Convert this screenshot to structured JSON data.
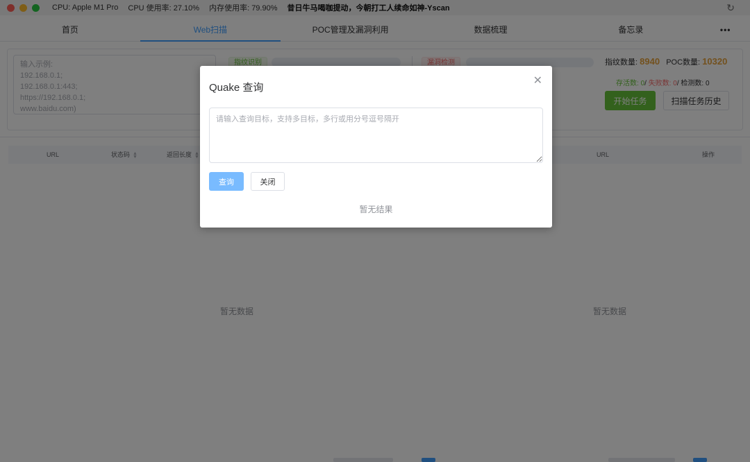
{
  "titlebar": {
    "cpu_model": "CPU: Apple M1 Pro",
    "cpu_usage": "CPU 使用率: 27.10%",
    "mem_usage": "内存使用率: 79.90%",
    "title": "昔日牛马喝咖提动，今朝打工人续命如神-Yscan"
  },
  "nav": {
    "tabs": [
      "首页",
      "Web扫描",
      "POC管理及漏洞利用",
      "数据梳理",
      "备忘录"
    ],
    "more": "•••",
    "active": "Web扫描"
  },
  "scan": {
    "target_placeholder": "输入示例:\n192.168.0.1;\n192.168.0.1:443;\nhttps://192.168.0.1;\nwww.baidu.com)",
    "fingerprint_tag": "指纹识别",
    "vuln_tag": "漏洞检测",
    "fingerprint_count_label": "指纹数量:",
    "fingerprint_count": "8940",
    "poc_count_label": "POC数量:",
    "poc_count": "10320",
    "alive_label": "存活数:",
    "alive": "0",
    "fail_label": "失败数:",
    "fail": "0",
    "detect_label": "检测数:",
    "detect": "0",
    "start_button": "开始任务",
    "history_button": "扫描任务历史"
  },
  "left_table": {
    "headers": [
      "URL",
      "状态码",
      "返回长度"
    ],
    "empty_text": "暂无数据"
  },
  "right_table": {
    "headers": [
      "URL",
      "操作"
    ],
    "empty_text": "暂无数据"
  },
  "dialog": {
    "title": "Quake 查询",
    "placeholder": "请输入查询目标，支持多目标，多行或用分号逗号隔开",
    "query_button": "查询",
    "close_button": "关闭",
    "empty_text": "暂无结果"
  },
  "colors": {
    "accent": "#409eff",
    "success": "#67c23a",
    "danger": "#f56c6c",
    "warning": "#e6a23c"
  },
  "icons": {
    "refresh": "refresh-icon",
    "close": "close-icon",
    "sort": "sort-icon"
  }
}
